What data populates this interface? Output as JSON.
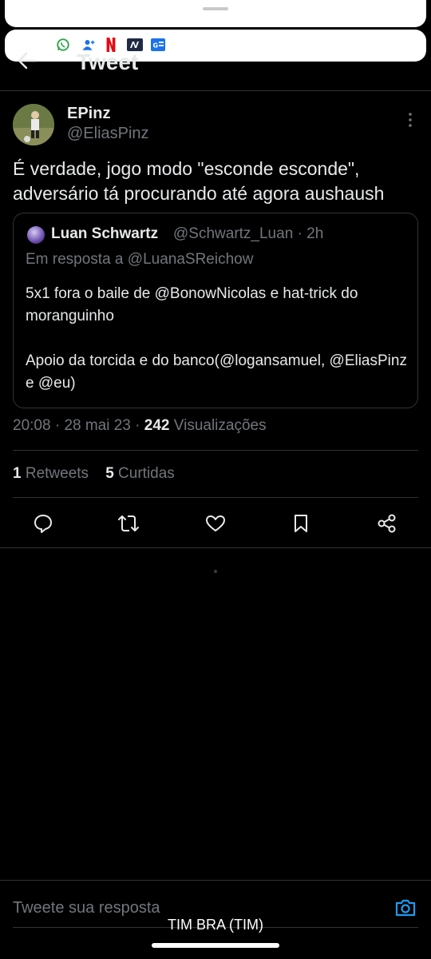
{
  "header": {
    "title": "Tweet"
  },
  "notification_icons": [
    "whatsapp-icon",
    "contact-add-icon",
    "netflix-icon",
    "n-app-icon",
    "news-icon"
  ],
  "tweet": {
    "display_name": "EPinz",
    "handle": "@EliasPinz",
    "text": "É verdade, jogo modo \"esconde esconde\", adversário tá procurando até agora aushaush",
    "time": "20:08",
    "date": "28 mai 23",
    "views_count": "242",
    "views_label": "Visualizações",
    "retweets_count": "1",
    "retweets_label": "Retweets",
    "likes_count": "5",
    "likes_label": "Curtidas"
  },
  "quoted_tweet": {
    "display_name": "Luan Schwartz",
    "handle": "@Schwartz_Luan",
    "age": "2h",
    "reply_to": "Em resposta a @LuanaSReichow",
    "body_line1": "5x1 fora o baile de @BonowNicolas e hat-trick do moranguinho",
    "body_line2": "Apoio da torcida e do banco(@logansamuel, @EliasPinz e @eu)"
  },
  "actions": [
    "reply-icon",
    "retweet-icon",
    "like-icon",
    "bookmark-icon",
    "share-icon"
  ],
  "reply_box": {
    "placeholder": "Tweete sua resposta"
  },
  "status_bar": {
    "carrier": "TIM BRA (TIM)"
  },
  "colors": {
    "background": "#000000",
    "text": "#e7e9ea",
    "muted": "#71767b",
    "accent": "#1d9bf0",
    "divider": "#2f3336"
  }
}
